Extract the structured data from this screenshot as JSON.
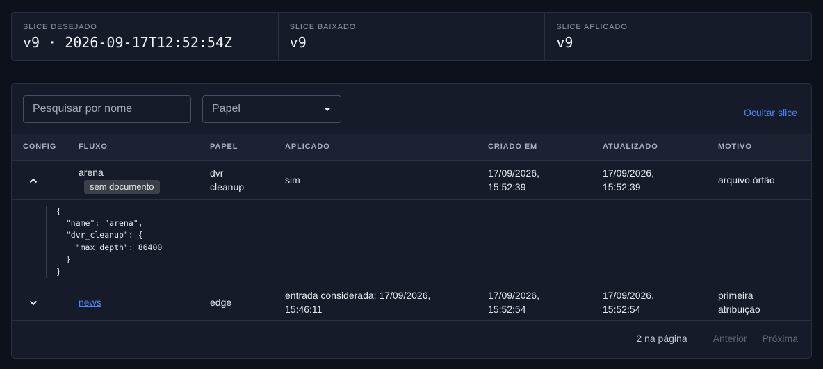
{
  "status": {
    "desired": {
      "label": "SLICE DESEJADO",
      "value": "v9 · 2026-09-17T12:52:54Z"
    },
    "downloaded": {
      "label": "SLICE BAIXADO",
      "value": "v9"
    },
    "applied": {
      "label": "SLICE APLICADO",
      "value": "v9"
    }
  },
  "toolbar": {
    "search_placeholder": "Pesquisar por nome",
    "role_select": "Papel",
    "hide_slice": "Ocultar slice"
  },
  "table": {
    "headers": [
      "CONFIG",
      "FLUXO",
      "PAPEL",
      "APLICADO",
      "CRIADO EM",
      "ATUALIZADO",
      "MOTIVO"
    ],
    "rows": [
      {
        "flow": "arena",
        "tag": "sem documento",
        "role_line1": "dvr",
        "role_line2": "cleanup",
        "applied": "sim",
        "created_line1": "17/09/2026,",
        "created_line2": "15:52:39",
        "updated_line1": "17/09/2026,",
        "updated_line2": "15:52:39",
        "reason": "arquivo órfão",
        "json": "{\n  \"name\": \"arena\",\n  \"dvr_cleanup\": {\n    \"max_depth\": 86400\n  }\n}"
      },
      {
        "flow": "news",
        "role": "edge",
        "applied_line1": "entrada considerada: 17/09/2026,",
        "applied_line2": "15:46:11",
        "created_line1": "17/09/2026,",
        "created_line2": "15:52:54",
        "updated_line1": "17/09/2026,",
        "updated_line2": "15:52:54",
        "reason_line1": "primeira",
        "reason_line2": "atribuição"
      }
    ]
  },
  "footer": {
    "count": "2 na página",
    "prev": "Anterior",
    "next": "Próxima"
  },
  "icons": {
    "collapse": "chevron-up-icon",
    "expand": "chevron-down-icon",
    "select_caret": "caret-down-icon"
  },
  "colors": {
    "accent": "#4f86f7",
    "background": "#0c111c",
    "surface": "#161b29"
  }
}
